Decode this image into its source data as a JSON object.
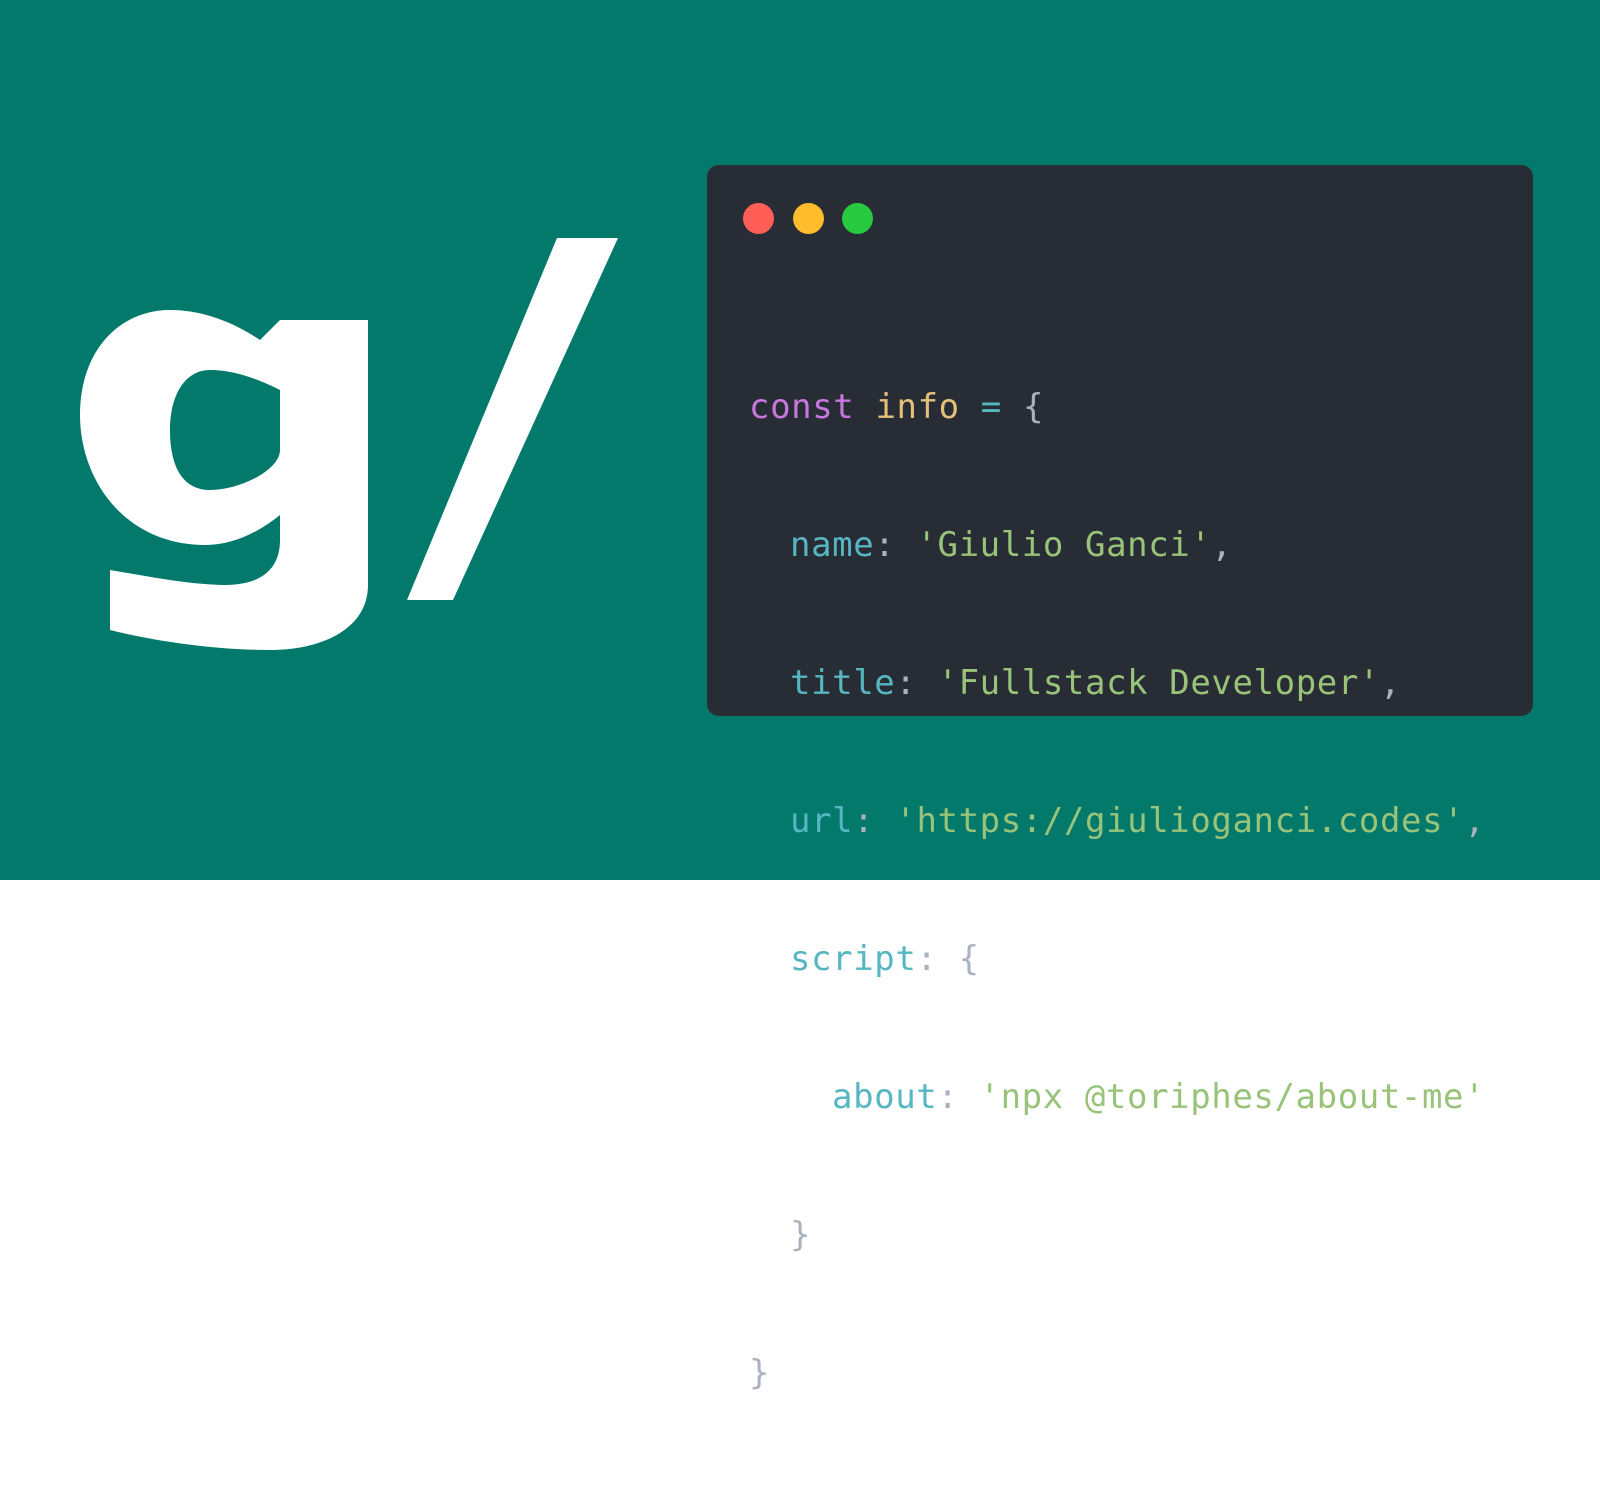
{
  "logo": {
    "text": "g/",
    "color": "#ffffff"
  },
  "colors": {
    "background": "#02796b",
    "window": "#282c35",
    "keyword": "#c678dd",
    "variable": "#e5c07b",
    "operator": "#56b6c2",
    "punctuation": "#abb2bf",
    "property": "#56b6c2",
    "string": "#98c379"
  },
  "window": {
    "buttons": [
      "red-close",
      "yellow-minimize",
      "green-maximize"
    ]
  },
  "code": {
    "line1": {
      "keyword": "const",
      "name": "info",
      "operator": "=",
      "brace": "{"
    },
    "line2": {
      "key": "name",
      "colon": ":",
      "value": "'Giulio Ganci'",
      "comma": ","
    },
    "line3": {
      "key": "title",
      "colon": ":",
      "value": "'Fullstack Developer'",
      "comma": ","
    },
    "line4": {
      "key": "url",
      "colon": ":",
      "value": "'https://giulioganci.codes'",
      "comma": ","
    },
    "line5": {
      "key": "script",
      "colon": ":",
      "brace": "{"
    },
    "line6": {
      "key": "about",
      "colon": ":",
      "value": "'npx @toriphes/about-me'"
    },
    "line7": {
      "brace": "}"
    },
    "line8": {
      "brace": "}"
    }
  }
}
